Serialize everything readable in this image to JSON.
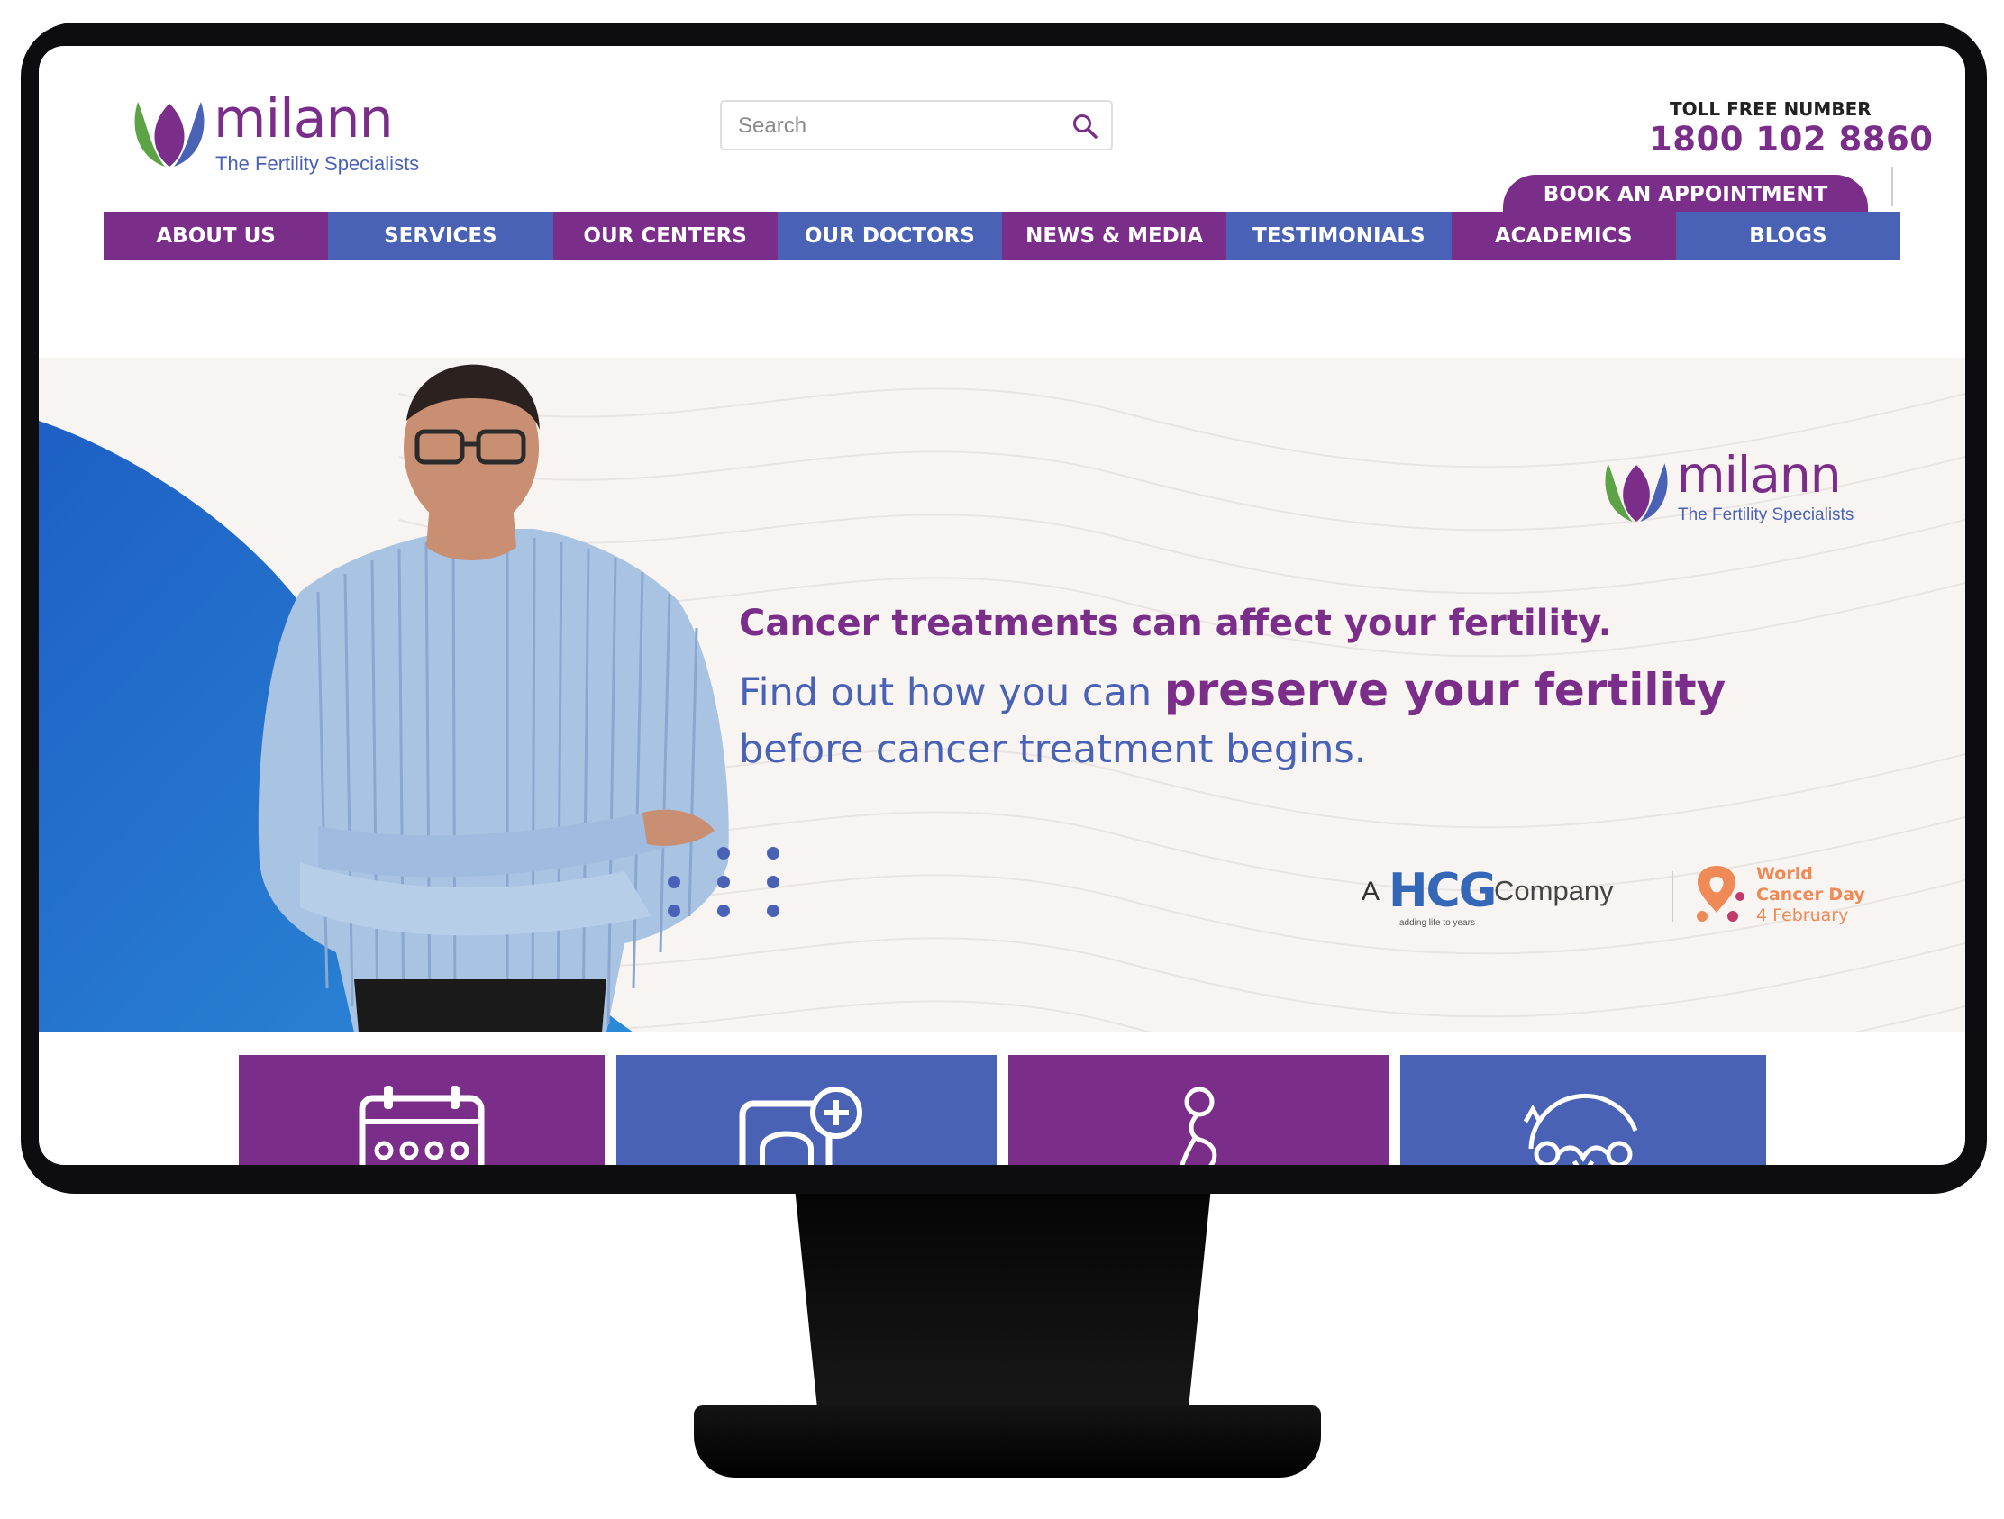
{
  "header": {
    "logo_word": "milann",
    "logo_tagline": "The Fertility Specialists",
    "search_placeholder": "Search",
    "toll_free_label": "TOLL FREE NUMBER",
    "toll_free_number": "1800 102 8860",
    "book_button": "BOOK AN APPOINTMENT"
  },
  "nav": {
    "items": [
      {
        "label": "ABOUT US"
      },
      {
        "label": "SERVICES"
      },
      {
        "label": "OUR CENTERS"
      },
      {
        "label": "OUR DOCTORS"
      },
      {
        "label": "NEWS & MEDIA"
      },
      {
        "label": "TESTIMONIALS"
      },
      {
        "label": "ACADEMICS"
      },
      {
        "label": "BLOGS"
      }
    ]
  },
  "hero": {
    "logo_word": "milann",
    "logo_tagline": "The Fertility Specialists",
    "line1": "Cancer treatments can affect your fertility.",
    "line2_pre": "Find out how you can ",
    "line2_strong": "preserve your fertility",
    "line3": "before cancer treatment begins.",
    "hcg_prefix": "A",
    "hcg_logo": "HCG",
    "hcg_tagline": "adding life to years",
    "hcg_suffix": "Company",
    "wcd_line1": "World",
    "wcd_line2": "Cancer Day",
    "wcd_line3": "4 February"
  },
  "tiles": [
    {
      "icon": "calendar-icon"
    },
    {
      "icon": "doctor-tablet-icon"
    },
    {
      "icon": "pregnant-woman-icon"
    },
    {
      "icon": "reproductive-system-icon"
    }
  ],
  "colors": {
    "brand_purple": "#7b2d8a",
    "brand_blue": "#4a62b5",
    "accent_orange": "#ef8a56"
  }
}
